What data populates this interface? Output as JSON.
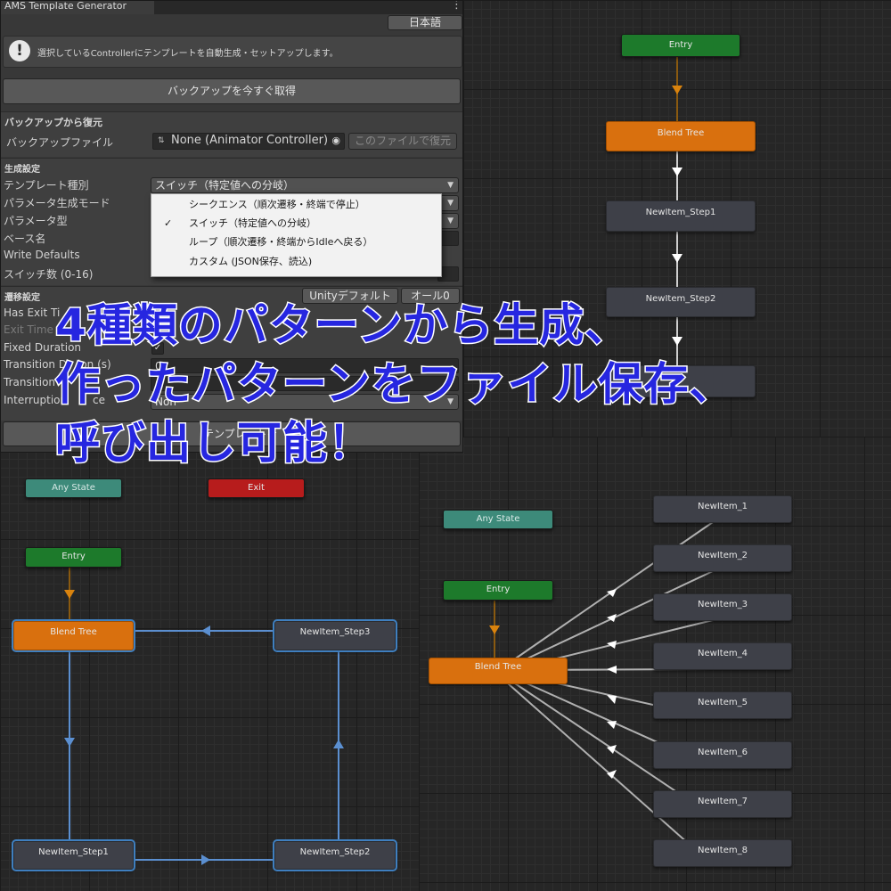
{
  "window": {
    "tab_title": "AMS Template Generator",
    "menu_glyph": "⋮"
  },
  "toolbar": {
    "language_button": "日本語"
  },
  "help": {
    "icon": "info-icon",
    "text": "選択しているControllerにテンプレートを自動生成・セットアップします。"
  },
  "backup": {
    "take_now_button": "バックアップを今すぐ取得"
  },
  "restore": {
    "header": "バックアップから復元",
    "file_label": "バックアップファイル",
    "file_value": "None (Animator Controller)",
    "restore_button": "このファイルで復元"
  },
  "generation": {
    "header": "生成設定",
    "labels": [
      "テンプレート種別",
      "パラメータ生成モード",
      "パラメータ型",
      "ベース名",
      "Write Defaults",
      "スイッチ数 (0-16)"
    ],
    "template_type_value": "スイッチ（特定値への分岐）",
    "menu_items": [
      {
        "label": "シークエンス（順次遷移・終端で停止）",
        "checked": false
      },
      {
        "label": "スイッチ（特定値への分岐）",
        "checked": true
      },
      {
        "label": "ループ（順次遷移・終端からIdleへ戻る）",
        "checked": false
      },
      {
        "label": "カスタム (JSON保存、読込)",
        "checked": false
      }
    ],
    "check_glyph": "✓",
    "switch_count_prefix": "0"
  },
  "transition": {
    "header": "遷移設定",
    "unity_default_button": "Unityデフォルト",
    "all_zero_button": "オール0",
    "labels": [
      "Has Exit Ti",
      "Exit Time",
      "Fixed Duration",
      "Transition D",
      "Transition",
      "Interruption"
    ],
    "label_suffix_transition_duration": "ion (s)",
    "label_suffix_interruption": "ce",
    "values": [
      "0",
      "0"
    ],
    "interruption_value": "Non"
  },
  "generate_button": "テンプレートを",
  "headline": [
    "4種類のパターンから生成、",
    "作ったパターンをファイル保存、",
    "呼び出し可能！"
  ],
  "graph_sequence": {
    "entry": "Entry",
    "blend": "Blend Tree",
    "step1": "NewItem_Step1",
    "step2": "NewItem_Step2"
  },
  "graph_loop": {
    "any": "Any State",
    "exit": "Exit",
    "entry": "Entry",
    "blend": "Blend Tree",
    "step1": "NewItem_Step1",
    "step2": "NewItem_Step2",
    "step3": "NewItem_Step3"
  },
  "graph_switch": {
    "any": "Any State",
    "entry": "Entry",
    "blend": "Blend Tree",
    "items": [
      "NewItem_1",
      "NewItem_2",
      "NewItem_3",
      "NewItem_4",
      "NewItem_5",
      "NewItem_6",
      "NewItem_7",
      "NewItem_8"
    ]
  },
  "colors": {
    "entry": "#1d7a2b",
    "blend": "#d9700e",
    "exit": "#b71c1c",
    "any": "#3d8a7a",
    "item": "#3e4048",
    "headline": "#2626e0",
    "loop_edge": "#5b8fd0"
  }
}
